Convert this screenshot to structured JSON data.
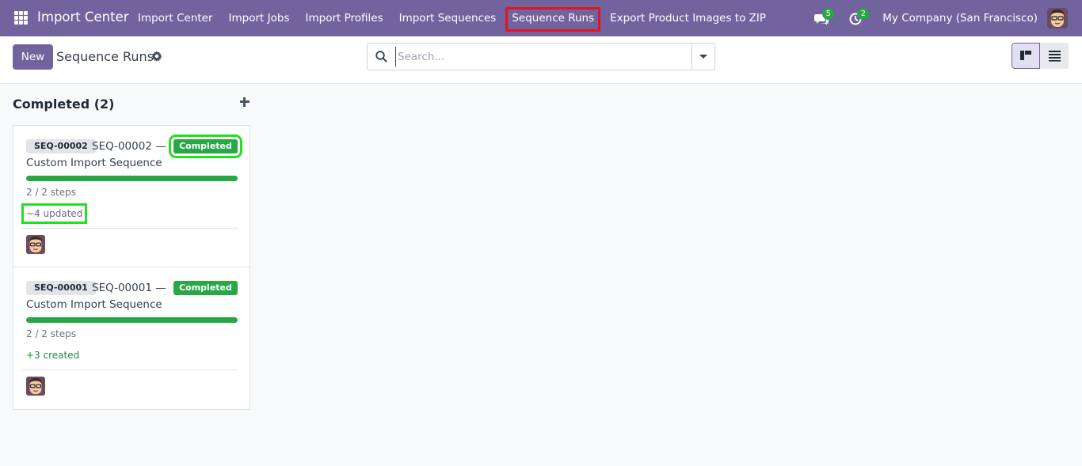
{
  "navbar": {
    "brand": "Import Center",
    "menu": [
      {
        "label": "Import Center"
      },
      {
        "label": "Import Jobs"
      },
      {
        "label": "Import Profiles"
      },
      {
        "label": "Import Sequences"
      },
      {
        "label": "Sequence Runs"
      },
      {
        "label": "Export Product Images to ZIP"
      }
    ],
    "messages_count": "5",
    "activities_count": "2",
    "company": "My Company (San Francisco)"
  },
  "control_panel": {
    "new_label": "New",
    "title": "Sequence Runs",
    "search_placeholder": "Search..."
  },
  "kanban": {
    "column_title": "Completed (2)",
    "cards": [
      {
        "ref": "SEQ-00002",
        "name_line1": "SEQ-00002 —",
        "name_line2": "Custom Import Sequence",
        "state": "Completed",
        "progress_fraction": 1.0,
        "steps": "2 / 2 steps",
        "result": "~4 updated"
      },
      {
        "ref": "SEQ-00001",
        "name_line1": "SEQ-00001 —",
        "name_line2": "Custom Import Sequence",
        "state": "Completed",
        "progress_fraction": 1.0,
        "steps": "2 / 2 steps",
        "result": "+3 created"
      }
    ]
  },
  "colors": {
    "brand": "#71639e",
    "success": "#28a745",
    "highlight_red": "#e0151f",
    "highlight_green": "#22e01f"
  }
}
